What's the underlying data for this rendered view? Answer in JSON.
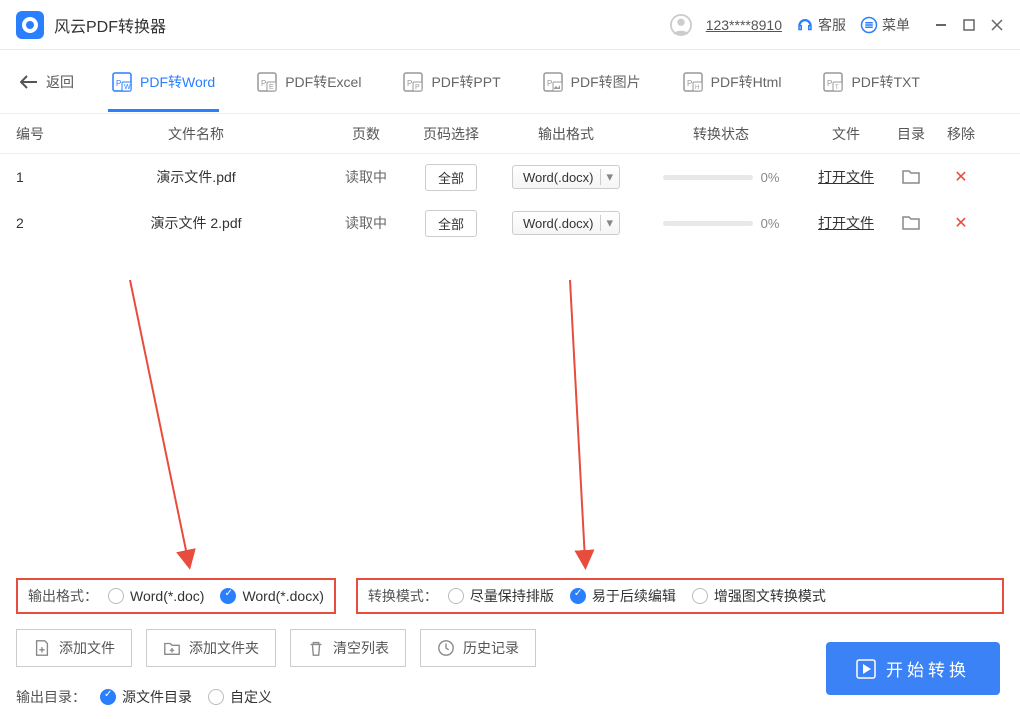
{
  "titlebar": {
    "app_name": "风云PDF转换器",
    "account": "123****8910",
    "service": "客服",
    "menu": "菜单"
  },
  "nav": {
    "back": "返回",
    "tabs": [
      {
        "label": "PDF转Word",
        "active": true
      },
      {
        "label": "PDF转Excel"
      },
      {
        "label": "PDF转PPT"
      },
      {
        "label": "PDF转图片"
      },
      {
        "label": "PDF转Html"
      },
      {
        "label": "PDF转TXT"
      }
    ]
  },
  "thead": {
    "idx": "编号",
    "name": "文件名称",
    "pages": "页数",
    "pagesel": "页码选择",
    "outfmt": "输出格式",
    "status": "转换状态",
    "file": "文件",
    "dir": "目录",
    "del": "移除"
  },
  "rows": [
    {
      "idx": "1",
      "name": "演示文件.pdf",
      "pages": "读取中",
      "pagesel": "全部",
      "outfmt": "Word(.docx)",
      "pct": "0%",
      "file": "打开文件"
    },
    {
      "idx": "2",
      "name": "演示文件 2.pdf",
      "pages": "读取中",
      "pagesel": "全部",
      "outfmt": "Word(.docx)",
      "pct": "0%",
      "file": "打开文件"
    }
  ],
  "output_format": {
    "label": "输出格式：",
    "options": [
      {
        "label": "Word(*.doc)",
        "checked": false
      },
      {
        "label": "Word(*.docx)",
        "checked": true
      }
    ]
  },
  "convert_mode": {
    "label": "转换模式：",
    "options": [
      {
        "label": "尽量保持排版",
        "checked": false
      },
      {
        "label": "易于后续编辑",
        "checked": true
      },
      {
        "label": "增强图文转换模式",
        "checked": false
      }
    ]
  },
  "actions": {
    "add_file": "添加文件",
    "add_folder": "添加文件夹",
    "clear": "清空列表",
    "history": "历史记录"
  },
  "outdir": {
    "label": "输出目录：",
    "options": [
      {
        "label": "源文件目录",
        "checked": true
      },
      {
        "label": "自定义",
        "checked": false
      }
    ]
  },
  "start_button": "开始转换"
}
